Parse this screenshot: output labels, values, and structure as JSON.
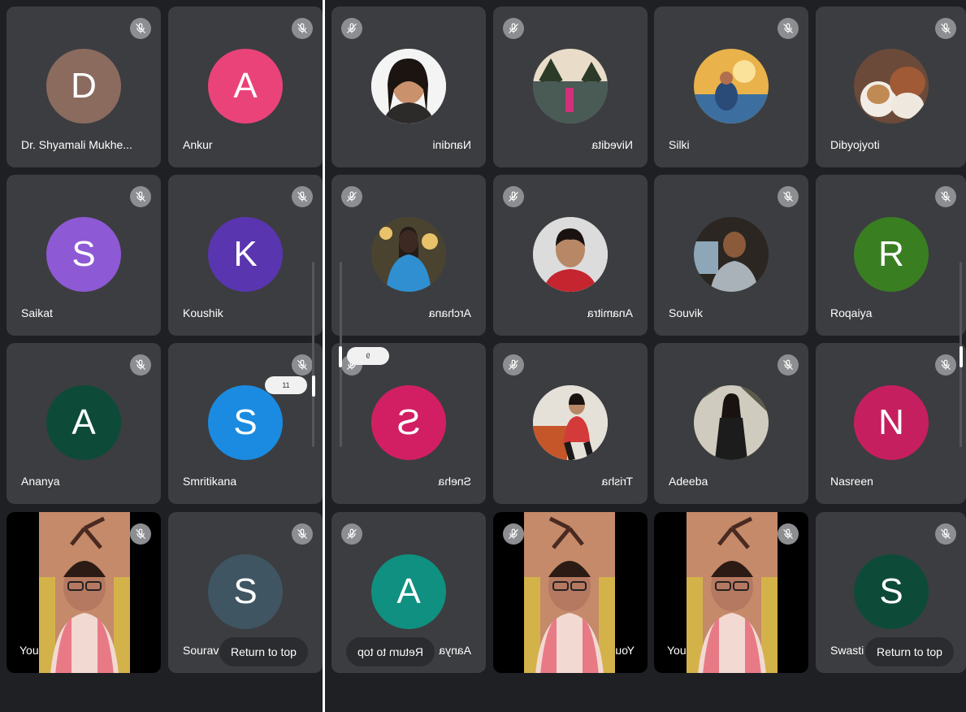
{
  "colors": {
    "background": "#1f2023",
    "tile": "#3c3d40",
    "mute_badge": "#8d8e91",
    "avatar_brown": "#8a6b5e",
    "avatar_pink": "#e9437a",
    "avatar_violet": "#8e59d4",
    "avatar_indigo": "#5a35b0",
    "avatar_dark_green": "#0d4b38",
    "avatar_blue": "#1a8be0",
    "avatar_slate": "#3f5562",
    "avatar_rose": "#d21f63",
    "avatar_teal": "#0f9080",
    "avatar_green": "#3a7e22",
    "avatar_magenta": "#c61f60"
  },
  "panel1": {
    "tiles": [
      {
        "name": "Dr. Shyamali Mukhe...",
        "initial": "D"
      },
      {
        "name": "Ankur",
        "initial": "A"
      },
      {
        "name": "Saikat",
        "initial": "S"
      },
      {
        "name": "Koushik",
        "initial": "K"
      },
      {
        "name": "Ananya",
        "initial": "A"
      },
      {
        "name": "Smritikana",
        "initial": "S"
      },
      {
        "name": "You"
      },
      {
        "name": "Sourav",
        "initial": "S"
      }
    ],
    "page_indicator": "11",
    "return_to_top": "Return to top"
  },
  "panel2": {
    "tiles": [
      {
        "name": "Nandini"
      },
      {
        "name": "Nivedita"
      },
      {
        "name": "Archana"
      },
      {
        "name": "Anamitra"
      },
      {
        "name": "Sneha",
        "initial": "S"
      },
      {
        "name": "Trisha"
      },
      {
        "name": "Aanya",
        "initial": "A"
      },
      {
        "name": "You"
      }
    ],
    "page_indicator": "9",
    "return_to_top": "Return to top"
  },
  "panel3": {
    "tiles": [
      {
        "name": "Silki"
      },
      {
        "name": "Dibyojyoti"
      },
      {
        "name": "Souvik"
      },
      {
        "name": "Roqaiya",
        "initial": "R"
      },
      {
        "name": "Adeeba"
      },
      {
        "name": "Nasreen",
        "initial": "N"
      },
      {
        "name": "You"
      },
      {
        "name": "Swasti",
        "initial": "S"
      }
    ],
    "return_to_top": "Return to top"
  },
  "icons": {
    "mute": "mic-off-icon",
    "connection": "connection-dot"
  }
}
